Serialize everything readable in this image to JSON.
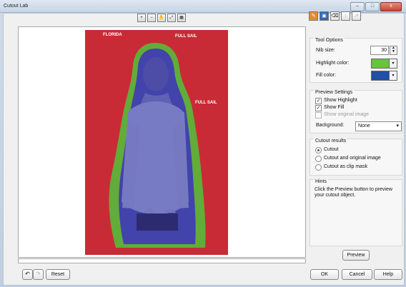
{
  "window": {
    "title": "Cutout Lab",
    "minimize": "–",
    "maximize": "□",
    "close": "x"
  },
  "toolbar": {
    "zoom_in": "+",
    "zoom_out": "−",
    "hand": "✋",
    "fit": "⤢",
    "actual": "▦"
  },
  "panel_tools": {
    "highlighter": "✎",
    "fill": "▣",
    "eraser": "⌫",
    "tool_a": "↕",
    "tool_b": "↗"
  },
  "tool_options": {
    "title": "Tool Options",
    "nib_label": "Nib size:",
    "nib_value": "30",
    "highlight_label": "Highlight color:",
    "fill_label": "Fill color:",
    "highlight_color": "#68c43f",
    "fill_color": "#1f4fa6"
  },
  "preview_settings": {
    "title": "Preview Settings",
    "show_highlight": "Show Highlight",
    "show_fill": "Show Fill",
    "show_original": "Show original image",
    "background_label": "Background:",
    "background_value": "None"
  },
  "cutout_results": {
    "title": "Cutout results",
    "options": [
      "Cutout",
      "Cutout and original image",
      "Cutout as clip mask"
    ]
  },
  "hints": {
    "title": "Hints",
    "text": "Click the Preview button to preview your cutout object."
  },
  "buttons": {
    "preview": "Preview",
    "reset": "Reset",
    "ok": "OK",
    "cancel": "Cancel",
    "help": "Help",
    "undo": "↶",
    "redo": "↷"
  },
  "image_text": {
    "full_sail": "FULL SAIL",
    "florida": "FLORIDA"
  }
}
